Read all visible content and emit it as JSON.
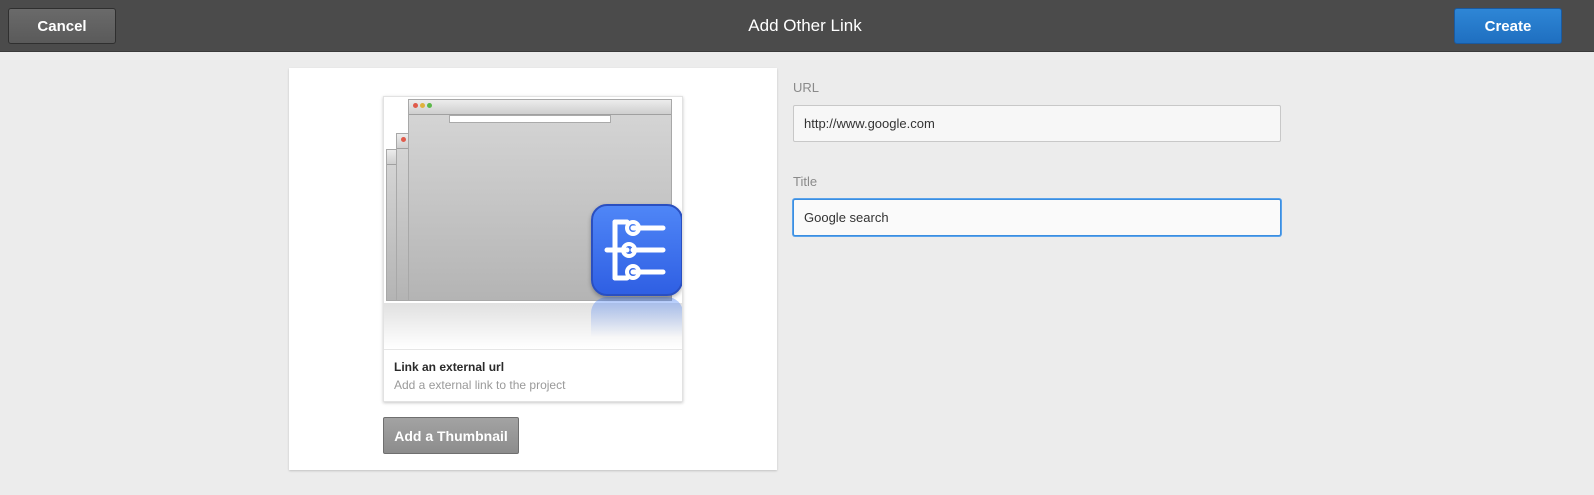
{
  "header": {
    "title": "Add Other Link",
    "cancel_label": "Cancel",
    "create_label": "Create"
  },
  "link_card": {
    "title": "Link an external url",
    "subtitle": "Add a external link to the project",
    "thumbnail_icon": "link-tree-app-icon",
    "add_thumbnail_label": "Add a Thumbnail"
  },
  "form": {
    "url": {
      "label": "URL",
      "value": "http://www.google.com"
    },
    "title": {
      "label": "Title",
      "value": "Google search"
    }
  },
  "colors": {
    "header_bg": "#4b4b4b",
    "create_button": "#2575c9",
    "page_bg": "#ececec",
    "focus_ring": "#3b8ee0",
    "app_icon_blue": "#3d6ff0"
  }
}
